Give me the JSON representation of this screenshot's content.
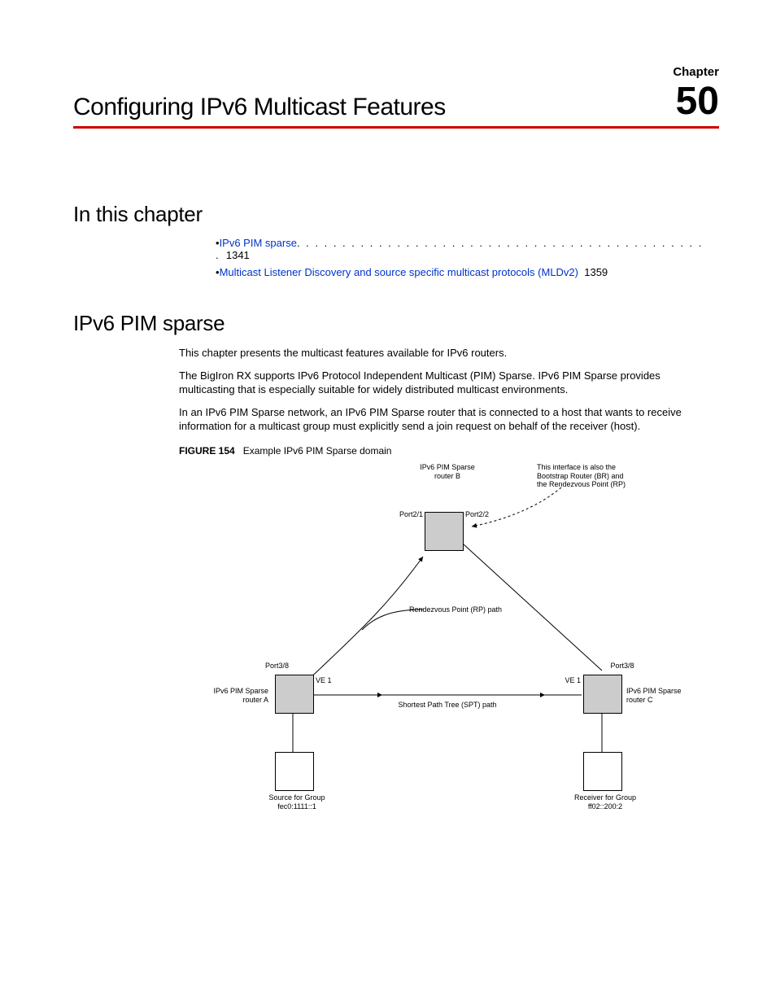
{
  "chapter_label": "Chapter",
  "chapter_number": "50",
  "title": "Configuring IPv6 Multicast Features",
  "section_in_this_chapter": "In this chapter",
  "toc": {
    "item1_link": "IPv6 PIM sparse",
    "item1_dots": ". . . . . . . . . . . . . . . . . . . . . . . . . . . . . . . . . . . . . . . . . . . . . .",
    "item1_page": "1341",
    "item2_link": "Multicast Listener Discovery and source specific multicast protocols (MLDv2)",
    "item2_page": "1359"
  },
  "section_ipv6": "IPv6 PIM sparse",
  "p1": "This chapter presents the multicast features available for IPv6 routers.",
  "p2": "The BigIron RX supports IPv6 Protocol Independent Multicast (PIM) Sparse. IPv6 PIM Sparse provides multicasting that is especially suitable for widely distributed multicast environments.",
  "p3": "In an IPv6 PIM Sparse network, an IPv6 PIM Sparse router that is connected to a host that wants to receive information for a multicast group must explicitly send a join request on behalf of the receiver (host).",
  "figure_label": "FIGURE 154",
  "figure_title": "Example IPv6 PIM Sparse domain",
  "d": {
    "routerB_l1": "IPv6 PIM Sparse",
    "routerB_l2": "router B",
    "br_rp_l1": "This interface is also the",
    "br_rp_l2": "Bootstrap Router (BR) and",
    "br_rp_l3": "the Rendezvous Point (RP)",
    "port21": "Port2/1",
    "port22": "Port2/2",
    "rp_path": "Rendezvous Point (RP) path",
    "port38a": "Port3/8",
    "port38c": "Port3/8",
    "ve1a": "VE 1",
    "ve1c": "VE 1",
    "routerA_l1": "IPv6 PIM Sparse",
    "routerA_l2": "router A",
    "routerC_l1": "IPv6 PIM Sparse",
    "routerC_l2": "router C",
    "spt": "Shortest Path Tree (SPT) path",
    "src_l1": "Source for Group",
    "src_l2": "fec0:1111::1",
    "rcv_l1": "Receiver for Group",
    "rcv_l2": "ff02::200:2"
  }
}
